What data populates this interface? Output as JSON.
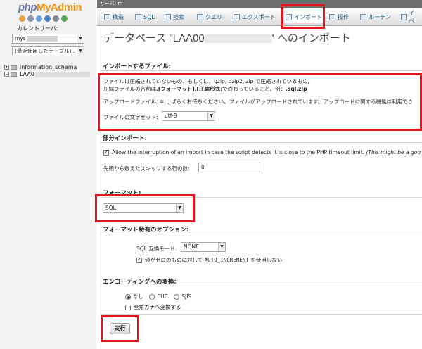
{
  "nav": {
    "logo_php": "php",
    "logo_my": "My",
    "logo_admin": "Admin",
    "server_label": "カレントサーバ:",
    "server_value": "mys",
    "recent_value": "(最近使用したテーブル) .",
    "databases": [
      {
        "name": "information_schema"
      },
      {
        "name": "LAA0"
      }
    ]
  },
  "topbar": {
    "text": "サーバ: m"
  },
  "tabs": [
    {
      "label": "構造",
      "active": false
    },
    {
      "label": "SQL",
      "active": false
    },
    {
      "label": "検索",
      "active": false
    },
    {
      "label": "クエリ",
      "active": false
    },
    {
      "label": "エクスポート",
      "active": false
    },
    {
      "label": "インポート",
      "active": true
    },
    {
      "label": "操作",
      "active": false
    },
    {
      "label": "ルーチン",
      "active": false
    },
    {
      "label": "イベ",
      "active": false
    }
  ],
  "page": {
    "title_prefix": "データベース \"LAA00",
    "title_suffix": "' へのインポート"
  },
  "import_file": {
    "heading": "インポートするファイル:",
    "compress_note": "ファイルは圧縮されていないもの、もしくは、gzip, bzip2, zip で圧縮されているもの。",
    "name_note_prefix": "圧縮ファイルの名前は",
    "name_note_bold": ".[フォーマット].[圧縮形式]",
    "name_note_mid": "で終わっていること。例：",
    "name_note_example": ".sql.zip",
    "upload_label": "アップロードファイル: ",
    "upload_status": " しばらくお待ちください。ファイルがアップロードされています。アップロードに関する機能は利用でき",
    "charset_label": "ファイルの文字セット:",
    "charset_value": "utf-8"
  },
  "partial": {
    "heading": "部分インポート:",
    "allow_interrupt": "Allow the interruption of an import in case the script detects it is close to the PHP timeout limit.",
    "allow_interrupt_note": "(This might be a goo",
    "skip_label": "先頭から数えたスキップする行の数:",
    "skip_value": "0"
  },
  "format": {
    "heading": "フォーマット:",
    "value": "SQL"
  },
  "format_options": {
    "heading": "フォーマット特有のオプション:",
    "compat_label": "SQL 互換モード:",
    "compat_value": "NONE",
    "zero_pre": "値がゼロのものに対して ",
    "zero_code": "AUTO_INCREMENT",
    "zero_post": " を使用しない"
  },
  "encoding": {
    "heading": "エンコーディングへの変換:",
    "options": [
      "なし",
      "EUC",
      "SJIS"
    ],
    "selected": "なし",
    "kana_label": "全角カナへ変換する"
  },
  "go_label": "実行",
  "colors": {
    "highlight": "#e0161f",
    "link": "#235a81",
    "logo_php": "#6c78af",
    "logo_myadmin": "#f29312"
  }
}
